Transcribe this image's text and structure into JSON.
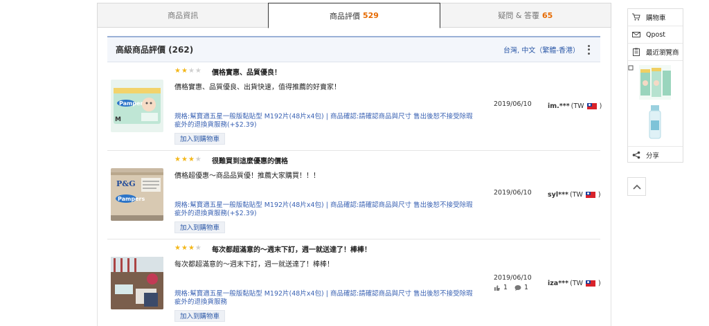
{
  "tabs": [
    {
      "label": "商品資訊",
      "count": ""
    },
    {
      "label": "商品評價",
      "count": "529"
    },
    {
      "label": "疑問 & 答覆",
      "count": "65"
    }
  ],
  "review_panel": {
    "title": "高級商品評價 (262)",
    "locale": "台灣, 中文（繁體-香港）"
  },
  "reviews": [
    {
      "rating": 2,
      "title": "價格實惠、品質優良！",
      "content": "價格實惠、品質優良、出貨快速，值得推薦的好賣家！",
      "spec": "規格:幫寶適五星一般版黏貼型 M192片(48片x4包) | 商品確認:請確認商品與尺寸 售出後恕不接受除瑕疵外的退換貨服務(+$2.39)",
      "cart_label": "加入到購物車",
      "date": "2019/06/10",
      "user": "im.***",
      "country": "(TW",
      "country_close": ")",
      "likes": "",
      "comments": ""
    },
    {
      "rating": 3,
      "title": "很難買到這麼優惠的價格",
      "content": "價格超優惠～商品品質優！推薦大家購買！！！",
      "spec": "規格:幫寶適五星一般版黏貼型 M192片(48片x4包) | 商品確認:請確認商品與尺寸 售出後恕不接受除瑕疵外的退換貨服務(+$2.39)",
      "cart_label": "加入到購物車",
      "date": "2019/06/10",
      "user": "syl***",
      "country": "(TW",
      "country_close": ")",
      "likes": "",
      "comments": ""
    },
    {
      "rating": 3,
      "title": "每次都超滿意的～週末下訂，週一就送達了！棒棒！",
      "content": "每次都超滿意的～週末下訂，週一就送達了！棒棒！",
      "spec": "規格:幫寶適五星一般版黏貼型 M192片(48片x4包) | 商品確認:請確認商品與尺寸 售出後恕不接受除瑕疵外的退換貨服務",
      "cart_label": "加入到購物車",
      "date": "2019/06/10",
      "user": "iza***",
      "country": "(TW",
      "country_close": ")",
      "likes": "1",
      "comments": "1"
    }
  ],
  "sidebar": {
    "cart": "購物車",
    "qpost": "Qpost",
    "recent": "最近瀏覽商",
    "share": "分享"
  },
  "colors": {
    "accent_blue": "#2e5aa8",
    "count_orange": "#e66a00",
    "star": "#f3b71a"
  }
}
